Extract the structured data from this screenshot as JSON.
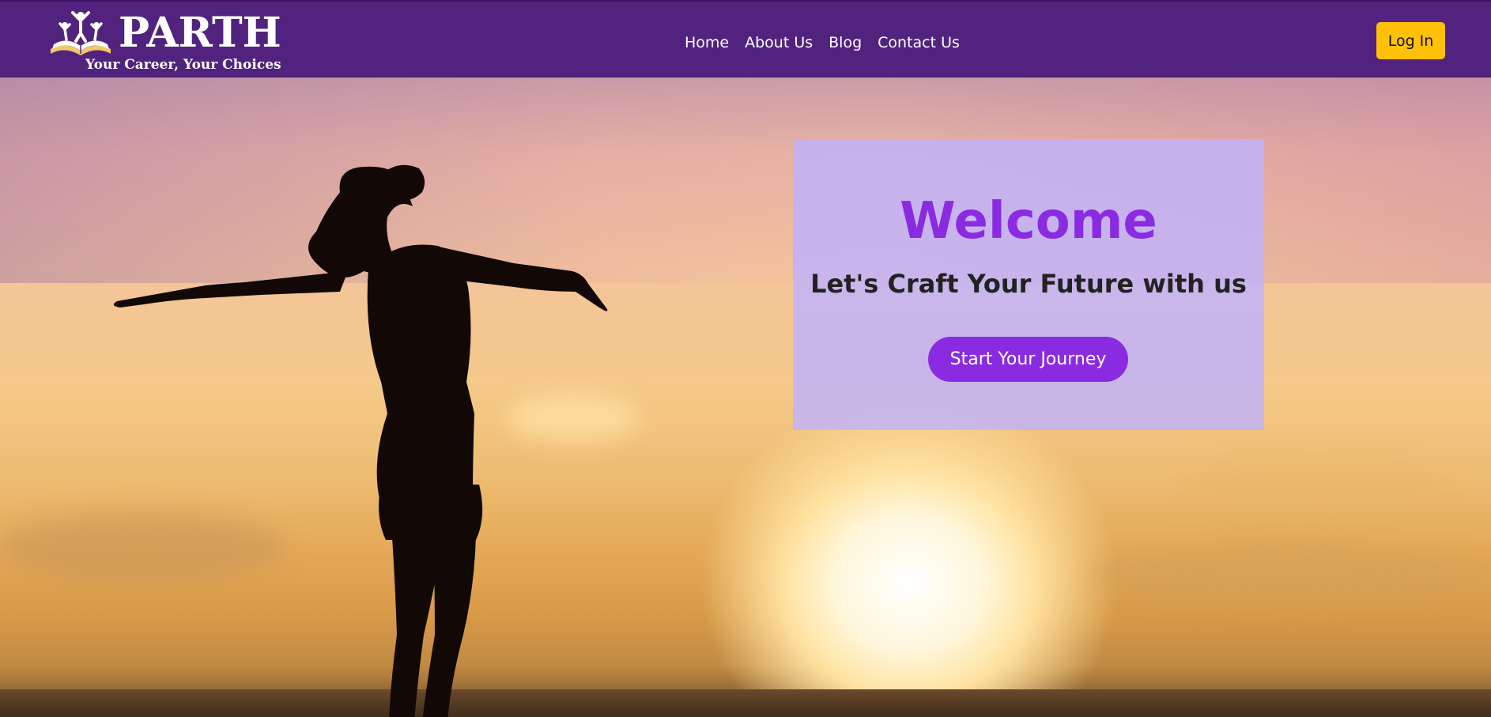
{
  "brand": {
    "name": "PARTH",
    "tagline": "Your Career, Your Choices"
  },
  "nav": {
    "links": [
      "Home",
      "About Us",
      "Blog",
      "Contact Us"
    ],
    "login_label": "Log In"
  },
  "hero": {
    "title": "Welcome",
    "subtitle": "Let's Craft Your Future with us",
    "cta_label": "Start Your Journey"
  },
  "colors": {
    "navbar": "#51237f",
    "login_button": "#ffc107",
    "accent_purple": "#8a2be2",
    "card": "#beb2ff"
  },
  "icons": {
    "brand_emblem": "book-with-people-logo"
  }
}
